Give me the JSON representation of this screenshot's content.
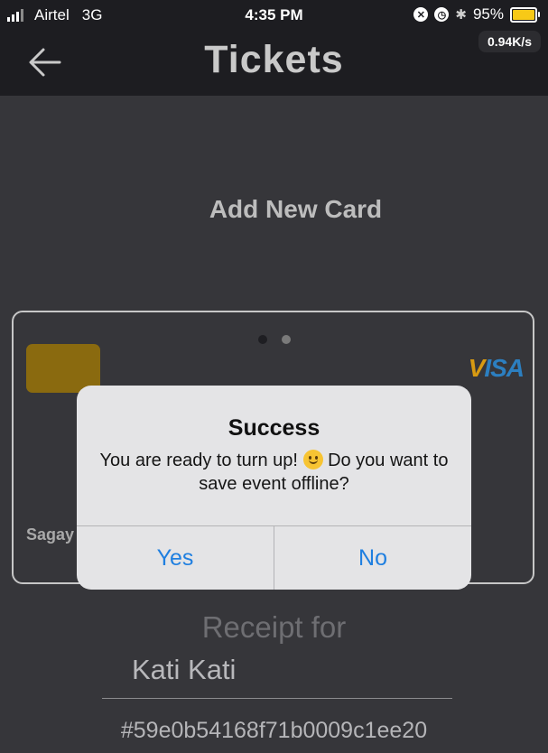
{
  "status_bar": {
    "carrier": "Airtel",
    "network": "3G",
    "time": "4:35 PM",
    "battery": "95%",
    "battery_color": "#f7c917"
  },
  "header": {
    "title": "Tickets",
    "net_speed": "0.94K/s",
    "back_icon": "arrow-left-icon"
  },
  "page": {
    "add_card_title": "Add New Card"
  },
  "card": {
    "brand": "VISA",
    "holder_name": "Sagay",
    "pager_count": 2,
    "pager_active": 2
  },
  "receipt": {
    "label": "Receipt for",
    "event_name": "Kati Kati",
    "order_id": "#59e0b54168f71b0009c1ee20"
  },
  "alert": {
    "title": "Success",
    "message_part1": "You are ready to turn up!",
    "message_part2": "Do you want to save event offline?",
    "emoji_icon": "smiling-face-icon",
    "yes_label": "Yes",
    "no_label": "No",
    "accent_color": "#1f7fe0"
  }
}
